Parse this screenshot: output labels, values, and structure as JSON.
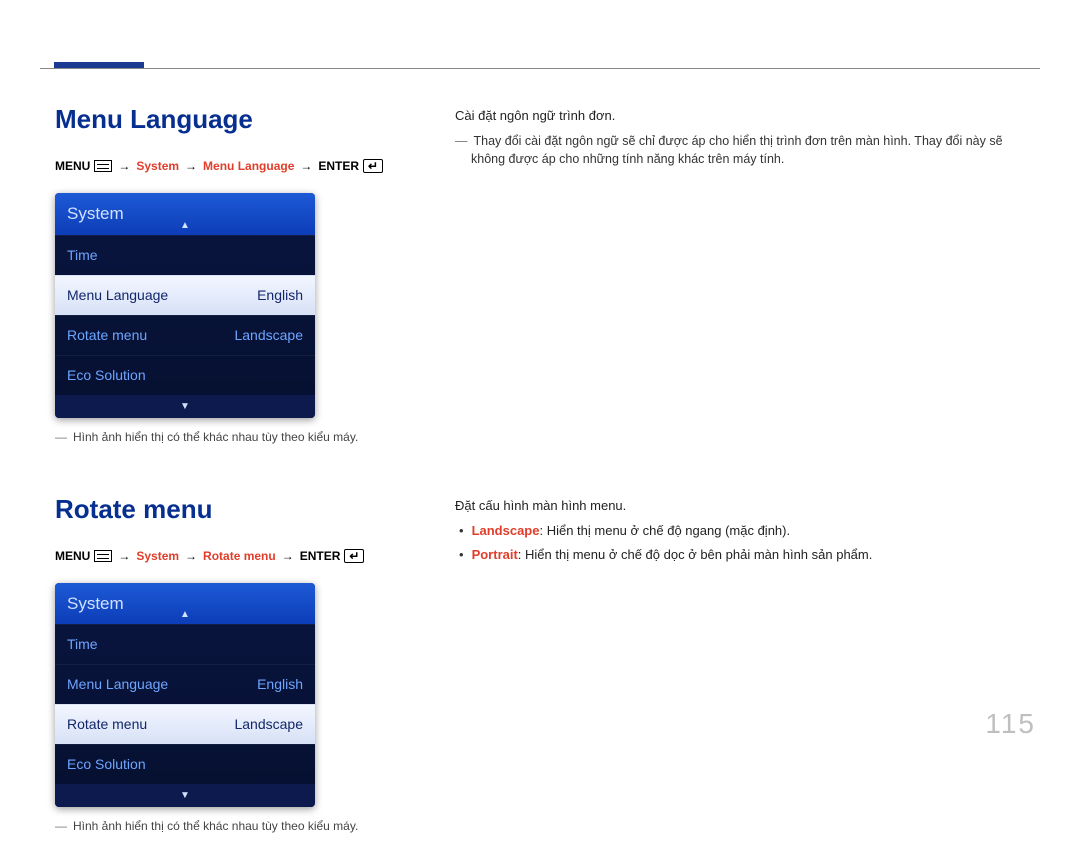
{
  "page_number": "115",
  "block1": {
    "title": "Menu Language",
    "breadcrumb": {
      "p1": "MENU",
      "p2": "System",
      "p3": "Menu Language",
      "p4": "ENTER"
    },
    "osd": {
      "header": "System",
      "rows": [
        {
          "label": "Time",
          "val": "",
          "selected": false
        },
        {
          "label": "Menu Language",
          "val": "English",
          "selected": true
        },
        {
          "label": "Rotate menu",
          "val": "Landscape",
          "selected": false
        },
        {
          "label": "Eco Solution",
          "val": "",
          "selected": false
        }
      ]
    },
    "caption": "Hình ảnh hiển thị có thể khác nhau tùy theo kiểu máy.",
    "desc": {
      "line1": "Cài đặt ngôn ngữ trình đơn.",
      "note": "Thay đổi cài đặt ngôn ngữ sẽ chỉ được áp cho hiển thị trình đơn trên màn hình. Thay đổi này sẽ không được áp cho những tính năng khác trên máy tính."
    }
  },
  "block2": {
    "title": "Rotate menu",
    "breadcrumb": {
      "p1": "MENU",
      "p2": "System",
      "p3": "Rotate menu",
      "p4": "ENTER"
    },
    "osd": {
      "header": "System",
      "rows": [
        {
          "label": "Time",
          "val": "",
          "selected": false
        },
        {
          "label": "Menu Language",
          "val": "English",
          "selected": false
        },
        {
          "label": "Rotate menu",
          "val": "Landscape",
          "selected": true
        },
        {
          "label": "Eco Solution",
          "val": "",
          "selected": false
        }
      ]
    },
    "caption": "Hình ảnh hiển thị có thể khác nhau tùy theo kiểu máy.",
    "desc": {
      "line1": "Đặt cấu hình màn hình menu.",
      "bullets": [
        {
          "key": "Landscape",
          "text": ": Hiển thị menu ở chế độ ngang (mặc định)."
        },
        {
          "key": "Portrait",
          "text": ": Hiển thị menu ở chế độ dọc ở bên phải màn hình sản phẩm."
        }
      ]
    }
  }
}
